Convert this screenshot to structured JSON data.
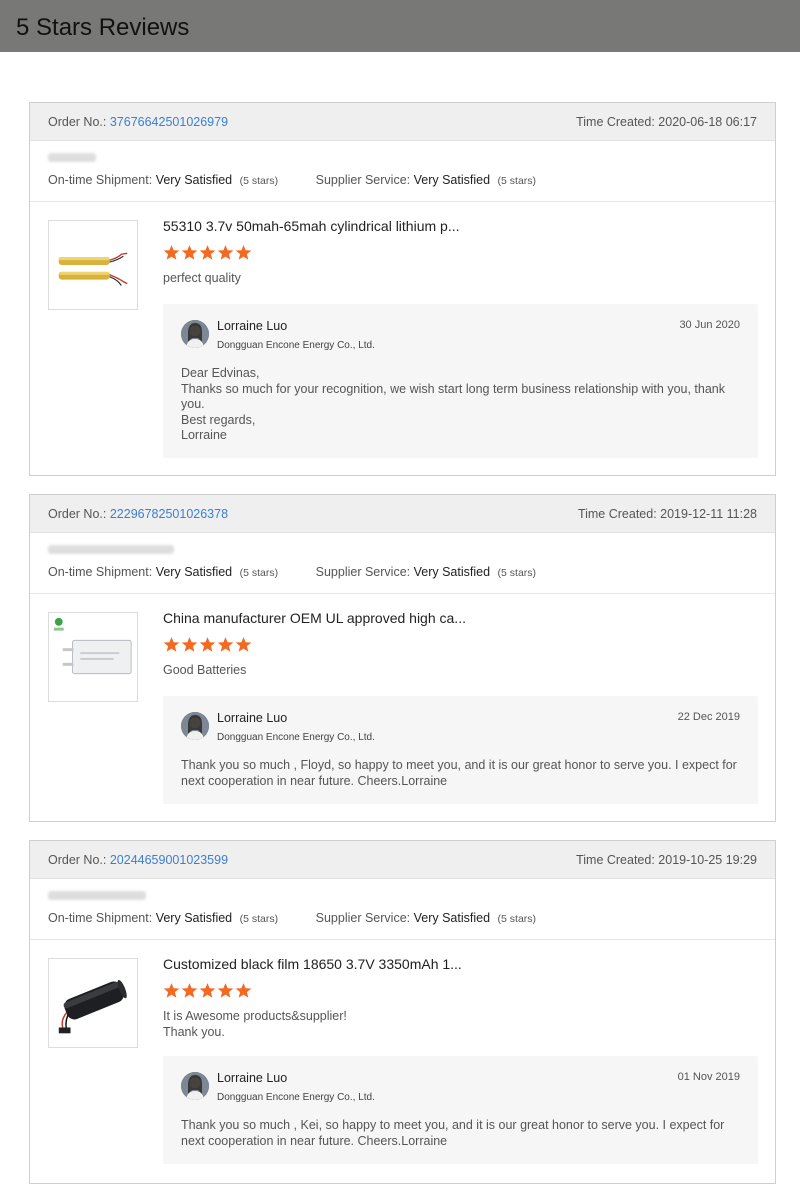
{
  "banner": {
    "title": "5 Stars Reviews"
  },
  "labels": {
    "order_no": "Order No.:",
    "time_created": "Time Created:",
    "ontime": "On-time Shipment:",
    "supplier": "Supplier Service:",
    "stars_note": "(5 stars)"
  },
  "colors": {
    "star": "#f26a22",
    "link": "#3b7fd1",
    "banner": "#787876"
  },
  "reviews": [
    {
      "order_no": "37676642501026979",
      "time_created": "2020-06-18 06:17",
      "ontime_value": "Very Satisfied",
      "supplier_value": "Very Satisfied",
      "product_title": "55310 3.7v 50mah-65mah cylindrical lithium p...",
      "rating": 5,
      "review_lines": [
        "perfect quality"
      ],
      "reply": {
        "name": "Lorraine Luo",
        "company": "Dongguan Encone Energy Co., Ltd.",
        "date": "30 Jun 2020",
        "lines": [
          "Dear Edvinas,",
          "Thanks so much for your recognition,  we wish start long term business relationship with you, thank you.",
          "Best regards,",
          "Lorraine"
        ]
      }
    },
    {
      "order_no": "22296782501026378",
      "time_created": "2019-12-11 11:28",
      "ontime_value": "Very Satisfied",
      "supplier_value": "Very Satisfied",
      "product_title": "China manufacturer OEM UL approved high ca...",
      "rating": 5,
      "review_lines": [
        "Good Batteries"
      ],
      "reply": {
        "name": "Lorraine Luo",
        "company": "Dongguan Encone Energy Co., Ltd.",
        "date": "22 Dec 2019",
        "lines": [
          "Thank you so much , Floyd, so happy to meet you,  and it is our great honor to serve you. I expect for next cooperation in near future. Cheers.Lorraine"
        ]
      }
    },
    {
      "order_no": "20244659001023599",
      "time_created": "2019-10-25 19:29",
      "ontime_value": "Very Satisfied",
      "supplier_value": "Very Satisfied",
      "product_title": "Customized black film 18650 3.7V 3350mAh 1...",
      "rating": 5,
      "review_lines": [
        "It is Awesome products&supplier!",
        "Thank you."
      ],
      "reply": {
        "name": "Lorraine Luo",
        "company": "Dongguan Encone Energy Co., Ltd.",
        "date": "01 Nov 2019",
        "lines": [
          "Thank you so much , Kei, so happy to meet you,  and it is our great honor to serve you. I expect for next cooperation in near future. Cheers.Lorraine"
        ]
      }
    }
  ]
}
